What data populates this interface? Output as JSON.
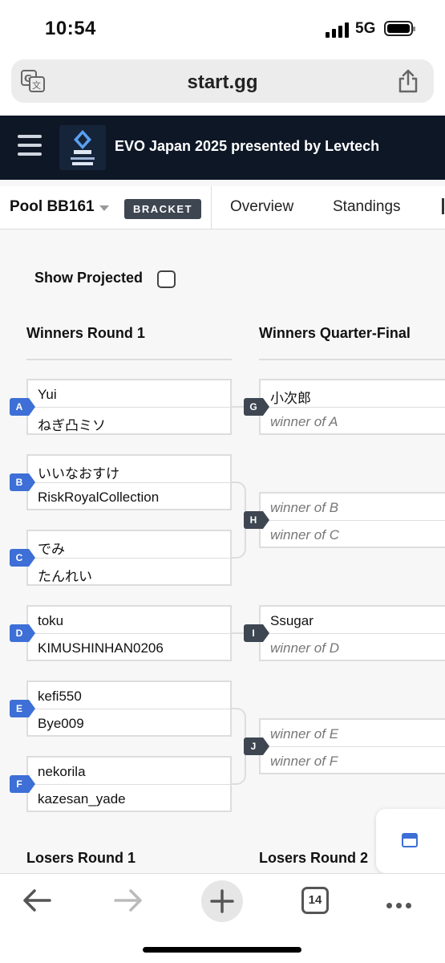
{
  "status_bar": {
    "time": "10:54",
    "network": "5G"
  },
  "browser": {
    "url": "start.gg",
    "tab_count": "14"
  },
  "site": {
    "title": "EVO Japan 2025 presented by Levtech"
  },
  "tabs": {
    "pool": "Pool BB161",
    "badge": "BRACKET",
    "items": [
      "Overview",
      "Standings"
    ]
  },
  "bracket": {
    "show_projected_label": "Show Projected",
    "show_projected_checked": false,
    "round_headers": [
      "Winners Round 1",
      "Winners Quarter-Final"
    ],
    "losers_headers": [
      "Losers Round 1",
      "Losers Round 2"
    ],
    "round1": [
      {
        "id": "A",
        "p1": "Yui",
        "p2": "ねぎ凸ミソ"
      },
      {
        "id": "B",
        "p1": "いいなおすけ",
        "p2": "RiskRoyalCollection"
      },
      {
        "id": "C",
        "p1": "でみ",
        "p2": "たんれい"
      },
      {
        "id": "D",
        "p1": "toku",
        "p2": "KIMUSHINHAN0206"
      },
      {
        "id": "E",
        "p1": "kefi550",
        "p2": "Bye009"
      },
      {
        "id": "F",
        "p1": "nekorila",
        "p2": "kazesan_yade"
      }
    ],
    "quarter": [
      {
        "id": "G",
        "p1": "小次郎",
        "p2": "winner of A"
      },
      {
        "id": "H",
        "p1": "winner of B",
        "p2": "winner of C"
      },
      {
        "id": "I",
        "p1": "Ssugar",
        "p2": "winner of D"
      },
      {
        "id": "J",
        "p1": "winner of E",
        "p2": "winner of F"
      }
    ]
  },
  "colors": {
    "header_bg": "#0e1726",
    "label_blue": "#3d6fd6",
    "label_dark": "#3e4652"
  },
  "icons": [
    "translate-icon",
    "share-icon",
    "menu-icon",
    "evo-logo",
    "back-icon",
    "forward-icon",
    "plus-icon",
    "tabs-icon",
    "more-icon",
    "panel-icon"
  ]
}
